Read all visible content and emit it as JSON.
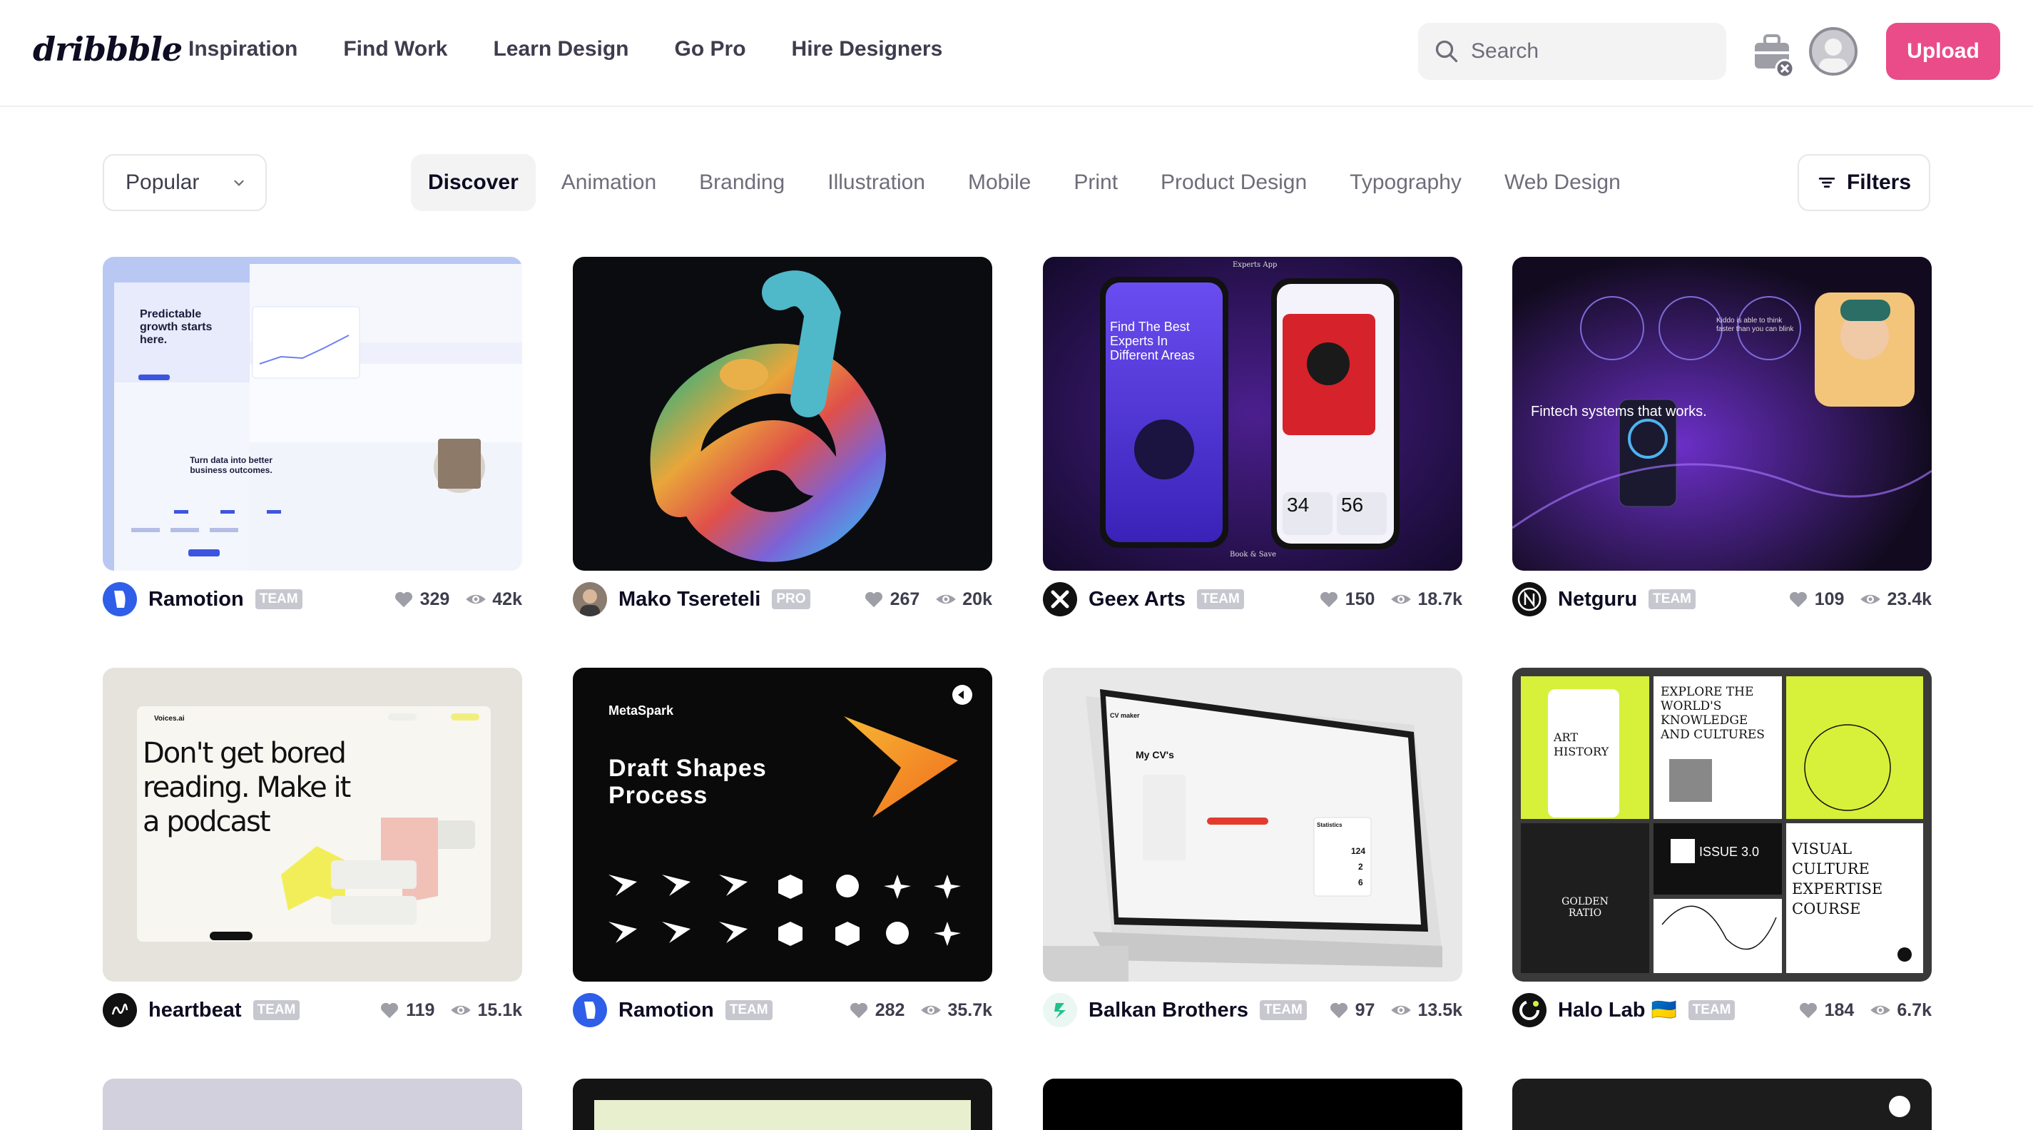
{
  "header": {
    "logo": "dribbble",
    "nav": [
      "Inspiration",
      "Find Work",
      "Learn Design",
      "Go Pro",
      "Hire Designers"
    ],
    "search_placeholder": "Search",
    "upload_label": "Upload"
  },
  "filters": {
    "sort_selected": "Popular",
    "categories": [
      "Discover",
      "Animation",
      "Branding",
      "Illustration",
      "Mobile",
      "Print",
      "Product Design",
      "Typography",
      "Web Design"
    ],
    "active_category": "Discover",
    "filters_label": "Filters"
  },
  "shots": [
    {
      "author": "Ramotion",
      "badge": "TEAM",
      "likes": "329",
      "views": "42k"
    },
    {
      "author": "Mako Tsereteli",
      "badge": "PRO",
      "likes": "267",
      "views": "20k"
    },
    {
      "author": "Geex Arts",
      "badge": "TEAM",
      "likes": "150",
      "views": "18.7k"
    },
    {
      "author": "Netguru",
      "badge": "TEAM",
      "likes": "109",
      "views": "23.4k"
    },
    {
      "author": "heartbeat",
      "badge": "TEAM",
      "likes": "119",
      "views": "15.1k"
    },
    {
      "author": "Ramotion",
      "badge": "TEAM",
      "likes": "282",
      "views": "35.7k"
    },
    {
      "author": "Balkan Brothers",
      "badge": "TEAM",
      "likes": "97",
      "views": "13.5k"
    },
    {
      "author": "Halo Lab 🇺🇦",
      "badge": "TEAM",
      "likes": "184",
      "views": "6.7k"
    }
  ],
  "shot_text": {
    "s1_headline": "Predictable growth starts here.",
    "s1_sub": "Turn data into better business outcomes.",
    "s3_app": "Experts App",
    "s3_title": "Find The Best Experts In Different Areas",
    "s3_n1": "34",
    "s3_n2": "56",
    "s3_bottom": "Book & Save",
    "s4_text": "Fintech systems that works.",
    "s4_kiddo": "Kiddo is able to think faster than you can blink",
    "s5_brand": "Voices.ai",
    "s5_title1": "Don't get bored",
    "s5_title2": "reading. Make it",
    "s5_title3": "a podcast",
    "s6_brand": "MetaSpark",
    "s6_title1": "Draft Shapes",
    "s6_title2": "Process",
    "s7_brand": "CV maker",
    "s7_title": "My CV's",
    "s7_stats": "Statistics",
    "s7_n1": "124",
    "s7_n2": "2",
    "s7_n3": "6",
    "s8_t1": "EXPLORE THE WORLD'S KNOWLEDGE AND CULTURES",
    "s8_t2": "ART HISTORY",
    "s8_t3": "GOLDEN RATIO",
    "s8_t4": "ISSUE 3.0",
    "s8_t5": "VISUAL CULTURE EXPERTISE COURSE"
  },
  "colors": {
    "brand_pink": "#ea4c89",
    "text_dark": "#0d0c22",
    "text_muted": "#6e6d7a",
    "badge_gray": "#c7c7cf"
  }
}
